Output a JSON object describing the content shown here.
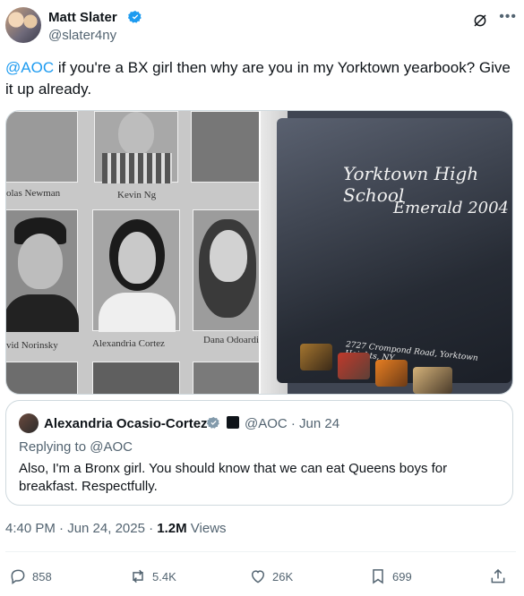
{
  "tweet": {
    "author_name": "Matt Slater",
    "handle": "@slater4ny",
    "text_mention": "@AOC",
    "text_body": " if you're a BX girl then why are you in my Yorktown yearbook? Give it up already.",
    "meta_time": "4:40 PM · Jun 24, 2025 · ",
    "views_count": "1.2M",
    "views_label": " Views"
  },
  "media": {
    "yearbook_names": [
      "olas Newman",
      "Kevin Ng",
      "vid Norinsky",
      "Alexandria Cortez",
      "Dana Odoardi"
    ],
    "cover_title": "Yorktown High School",
    "cover_subtitle": "Emerald 2004",
    "cover_address": "2727 Crompond Road, Yorktown Heights, NY"
  },
  "quote": {
    "name": "Alexandria Ocasio-Cortez",
    "handle_time": "@AOC · Jun 24",
    "replying": "Replying to @AOC",
    "text": "Also, I'm a Bronx girl. You should know that we can eat Queens boys for breakfast. Respectfully."
  },
  "actions": {
    "replies": "858",
    "reposts": "5.4K",
    "likes": "26K",
    "bookmarks": "699"
  },
  "colors": {
    "accent": "#1d9bf0",
    "secondary_text": "#536471",
    "border": "#cfd9de"
  }
}
